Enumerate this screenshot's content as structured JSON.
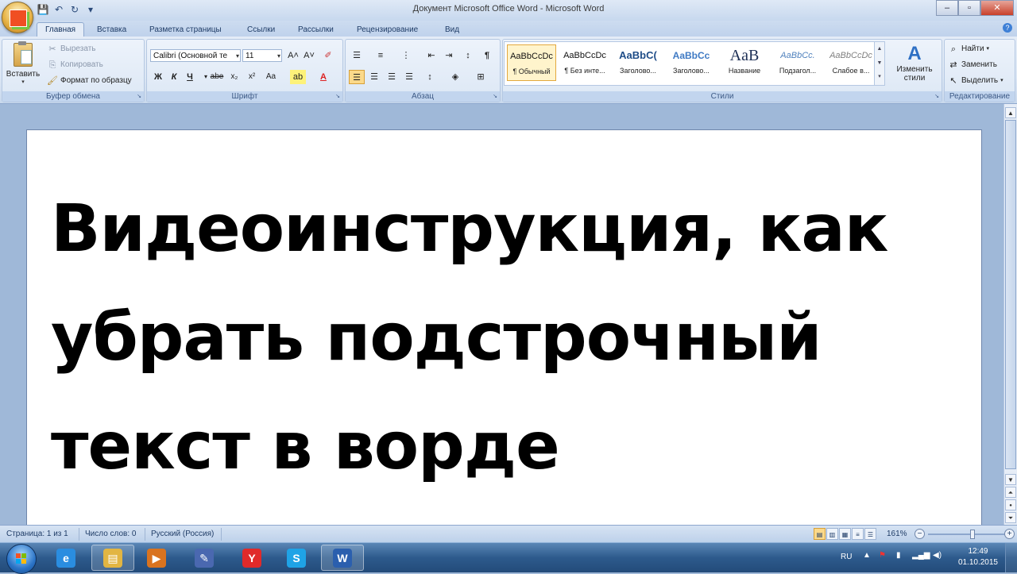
{
  "window": {
    "title": "Документ Microsoft Office Word - Microsoft Word",
    "controls": [
      "–",
      "▫",
      "✕"
    ]
  },
  "quick_access": [
    "💾",
    "↶",
    "↻",
    "▾"
  ],
  "tabs": [
    "Главная",
    "Вставка",
    "Разметка страницы",
    "Ссылки",
    "Рассылки",
    "Рецензирование",
    "Вид"
  ],
  "active_tab": "Главная",
  "ribbon": {
    "clipboard": {
      "label": "Буфер обмена",
      "paste": "Вставить",
      "cut": "Вырезать",
      "copy": "Копировать",
      "format_painter": "Формат по образцу"
    },
    "font": {
      "label": "Шрифт",
      "font_name": "Calibri (Основной те",
      "font_size": "11",
      "bold": "Ж",
      "italic": "К",
      "underline": "Ч",
      "strike": "abe",
      "subscript": "x₂",
      "superscript": "x²",
      "case": "Aa",
      "grow": "A˄",
      "shrink": "A˅"
    },
    "paragraph": {
      "label": "Абзац",
      "pilcrow": "¶"
    },
    "styles": {
      "label": "Стили",
      "items": [
        {
          "sample": "AaBbCcDc",
          "name": "¶ Обычный"
        },
        {
          "sample": "AaBbCcDc",
          "name": "¶ Без инте..."
        },
        {
          "sample": "AaBbC(",
          "name": "Заголово..."
        },
        {
          "sample": "AaBbCc",
          "name": "Заголово..."
        },
        {
          "sample": "AaB",
          "name": "Название"
        },
        {
          "sample": "AaBbCc.",
          "name": "Подзагол..."
        },
        {
          "sample": "AaBbCcDc",
          "name": "Слабое в..."
        }
      ],
      "change_styles_line1": "Изменить",
      "change_styles_line2": "стили"
    },
    "editing": {
      "label": "Редактирование",
      "find": "Найти",
      "replace": "Заменить",
      "select": "Выделить"
    }
  },
  "document": {
    "text_lines": [
      "Видеоинструкция, как",
      "убрать подстрочный",
      "текст в ворде"
    ]
  },
  "status": {
    "page": "Страница: 1 из 1",
    "words": "Число слов: 0",
    "language": "Русский (Россия)",
    "zoom": "161%",
    "zoom_fraction": 0.58
  },
  "taskbar": {
    "lang": "RU",
    "time": "12:49",
    "date": "01.10.2015",
    "apps": [
      {
        "name": "ie",
        "glyph": "e",
        "color": "#2a8de0"
      },
      {
        "name": "explorer",
        "glyph": "▤",
        "color": "#e2b542"
      },
      {
        "name": "media",
        "glyph": "▶",
        "color": "#d9731f"
      },
      {
        "name": "paint",
        "glyph": "✎",
        "color": "#4a68b0"
      },
      {
        "name": "yandex",
        "glyph": "Y",
        "color": "#e02a2a"
      },
      {
        "name": "skype",
        "glyph": "S",
        "color": "#1fa3e6"
      },
      {
        "name": "word",
        "glyph": "W",
        "color": "#2b5fae"
      }
    ]
  }
}
